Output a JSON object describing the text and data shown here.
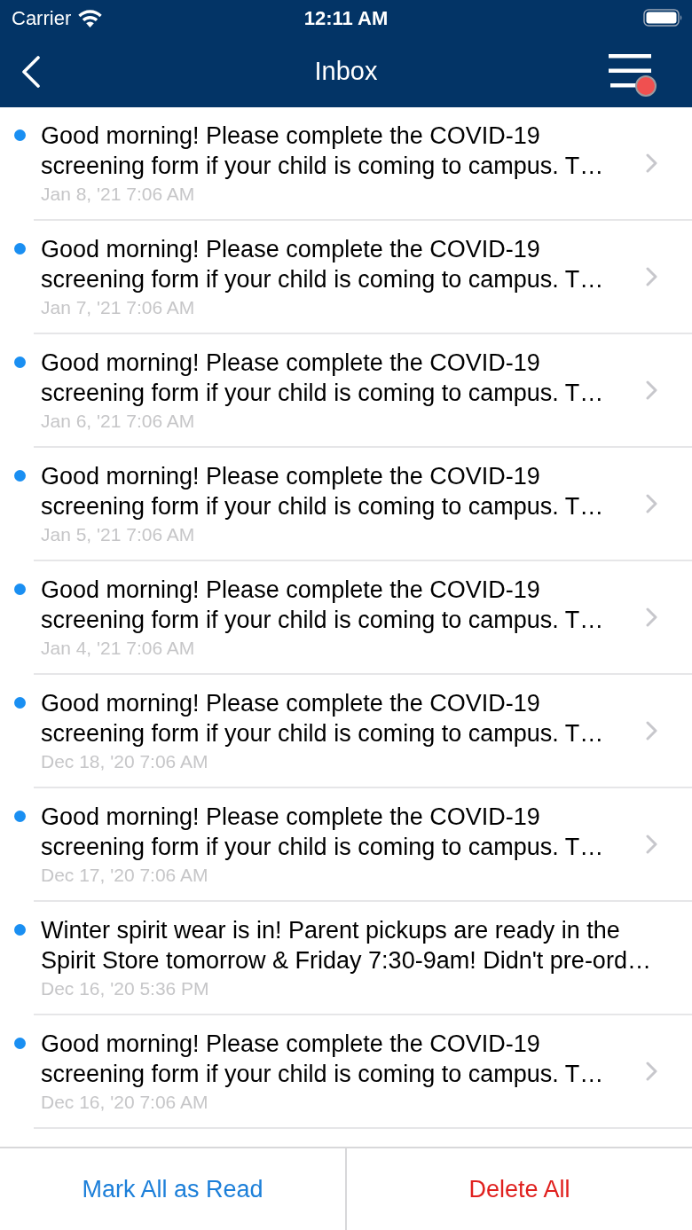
{
  "status_bar": {
    "carrier": "Carrier",
    "time": "12:11 AM"
  },
  "nav_bar": {
    "title": "Inbox",
    "menu_badge": true
  },
  "messages": [
    {
      "text": "Good morning! Please complete the COVID-19 screening form if your child is coming to campus. T…",
      "date": "Jan 8, '21 7:06 AM",
      "unread": true,
      "has_chevron": true
    },
    {
      "text": "Good morning! Please complete the COVID-19 screening form if your child is coming to campus. T…",
      "date": "Jan 7, '21 7:06 AM",
      "unread": true,
      "has_chevron": true
    },
    {
      "text": "Good morning! Please complete the COVID-19 screening form if your child is coming to campus. T…",
      "date": "Jan 6, '21 7:06 AM",
      "unread": true,
      "has_chevron": true
    },
    {
      "text": "Good morning! Please complete the COVID-19 screening form if your child is coming to campus. T…",
      "date": "Jan 5, '21 7:06 AM",
      "unread": true,
      "has_chevron": true
    },
    {
      "text": "Good morning! Please complete the COVID-19 screening form if your child is coming to campus. T…",
      "date": "Jan 4, '21 7:06 AM",
      "unread": true,
      "has_chevron": true
    },
    {
      "text": "Good morning! Please complete the COVID-19 screening form if your child is coming to campus. T…",
      "date": "Dec 18, '20 7:06 AM",
      "unread": true,
      "has_chevron": true
    },
    {
      "text": "Good morning! Please complete the COVID-19 screening form if your child is coming to campus. T…",
      "date": "Dec 17, '20 7:06 AM",
      "unread": true,
      "has_chevron": true
    },
    {
      "text": "Winter spirit wear is in! Parent pickups are ready in the Spirit Store tomorrow & Friday 7:30-9am! Didn't pre-ord…",
      "date": "Dec 16, '20 5:36 PM",
      "unread": true,
      "has_chevron": false
    },
    {
      "text": "Good morning! Please complete the COVID-19 screening form if your child is coming to campus. T…",
      "date": "Dec 16, '20 7:06 AM",
      "unread": true,
      "has_chevron": true
    }
  ],
  "actions": [
    {
      "label": "Mark All as Read",
      "kind": "default"
    },
    {
      "label": "Delete All",
      "kind": "destructive"
    }
  ]
}
